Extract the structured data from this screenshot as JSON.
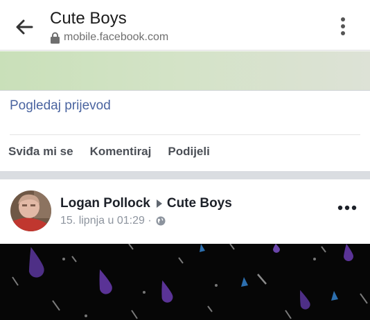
{
  "browser": {
    "title": "Cute Boys",
    "url": "mobile.facebook.com",
    "back_icon": "arrow-left-icon",
    "menu_icon": "more-vertical-icon"
  },
  "previous_post": {
    "translate_link": "Pogledaj prijevod",
    "actions": {
      "like": "Sviđa mi se",
      "comment": "Komentiraj",
      "share": "Podijeli"
    }
  },
  "post": {
    "author": "Logan Pollock",
    "group": "Cute Boys",
    "timestamp": "15. lipnja u 01:29 ·",
    "privacy_icon": "globe-icon",
    "options_icon": "more-horizontal-icon"
  },
  "colors": {
    "link": "#4a64a0",
    "action_text": "#4b4f56",
    "separator": "#dadde1",
    "image_background": "#060606"
  }
}
